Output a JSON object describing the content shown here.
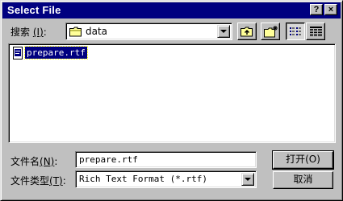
{
  "window": {
    "title": "Select File",
    "help_label": "?",
    "close_label": "×"
  },
  "lookin": {
    "label": "搜索",
    "accel": "(I)",
    "accel_suffix": ":",
    "value": "data"
  },
  "files": [
    {
      "name": "prepare.rtf",
      "selected": true
    }
  ],
  "filename": {
    "label": "文件名",
    "accel": "(N)",
    "accel_suffix": ":",
    "value": "prepare.rtf"
  },
  "filetype": {
    "label": "文件类型",
    "accel": "(T)",
    "accel_suffix": ":",
    "value": "Rich Text Format (*.rtf)"
  },
  "buttons": {
    "open": "打开(O)",
    "cancel": "取消"
  },
  "icons": {
    "folder": "folder-icon",
    "up": "up-folder-icon",
    "newfolder": "new-folder-icon",
    "list": "list-view-icon",
    "details": "details-view-icon",
    "rtf": "rtf-file-icon"
  },
  "colors": {
    "titlebar": "#000080",
    "selection": "#000080",
    "face": "#c0c0c0"
  }
}
